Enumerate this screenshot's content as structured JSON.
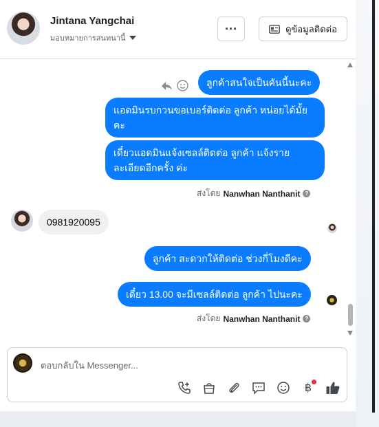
{
  "header": {
    "name": "Jintana Yangchai",
    "assign_label": "มอบหมายการสนทนานี้",
    "more_label": "···",
    "contact_info_label": "ดูข้อมูลติดต่อ"
  },
  "messages": {
    "out1": "ลูกค้าสนใจเป็นคันนี้นะคะ",
    "out2": "แอดมินรบกวนขอเบอร์ติดต่อ ลูกค้า  หน่อยได้มั้ยคะ",
    "out3": "เดี๋ยวแอดมินแจ้งเซลล์ติดต่อ ลูกค้า  แจ้งรายละเอียดอีกครั้ง ค่ะ",
    "sent_by_prefix_1": "ส่งโดย",
    "sent_by_name_1": "Nanwhan Nanthanit",
    "in1": "0981920095",
    "out4": "ลูกค้า  สะดวกให้ติดต่อ ช่วงกี่โมงดีคะ",
    "out5": "เดี๋ยว 13.00 จะมีเซลล์ติดต่อ ลูกค้า ไปนะคะ",
    "sent_by_prefix_2": "ส่งโดย",
    "sent_by_name_2": "Nanwhan Nanthanit",
    "help_mark": "?"
  },
  "composer": {
    "placeholder": "ตอบกลับใน Messenger...",
    "baht_symbol": "฿"
  },
  "colors": {
    "outgoing_bubble": "#0a7cff",
    "incoming_bubble": "#f0f0f0",
    "notification_dot": "#f02849"
  },
  "icons": [
    "ellipsis-icon",
    "contact-card-icon",
    "chevron-down-icon",
    "reply-icon",
    "emoji-icon",
    "call-icon",
    "bag-icon",
    "attach-icon",
    "chat-icon",
    "smile-icon",
    "baht-icon",
    "thumbs-up-icon"
  ]
}
